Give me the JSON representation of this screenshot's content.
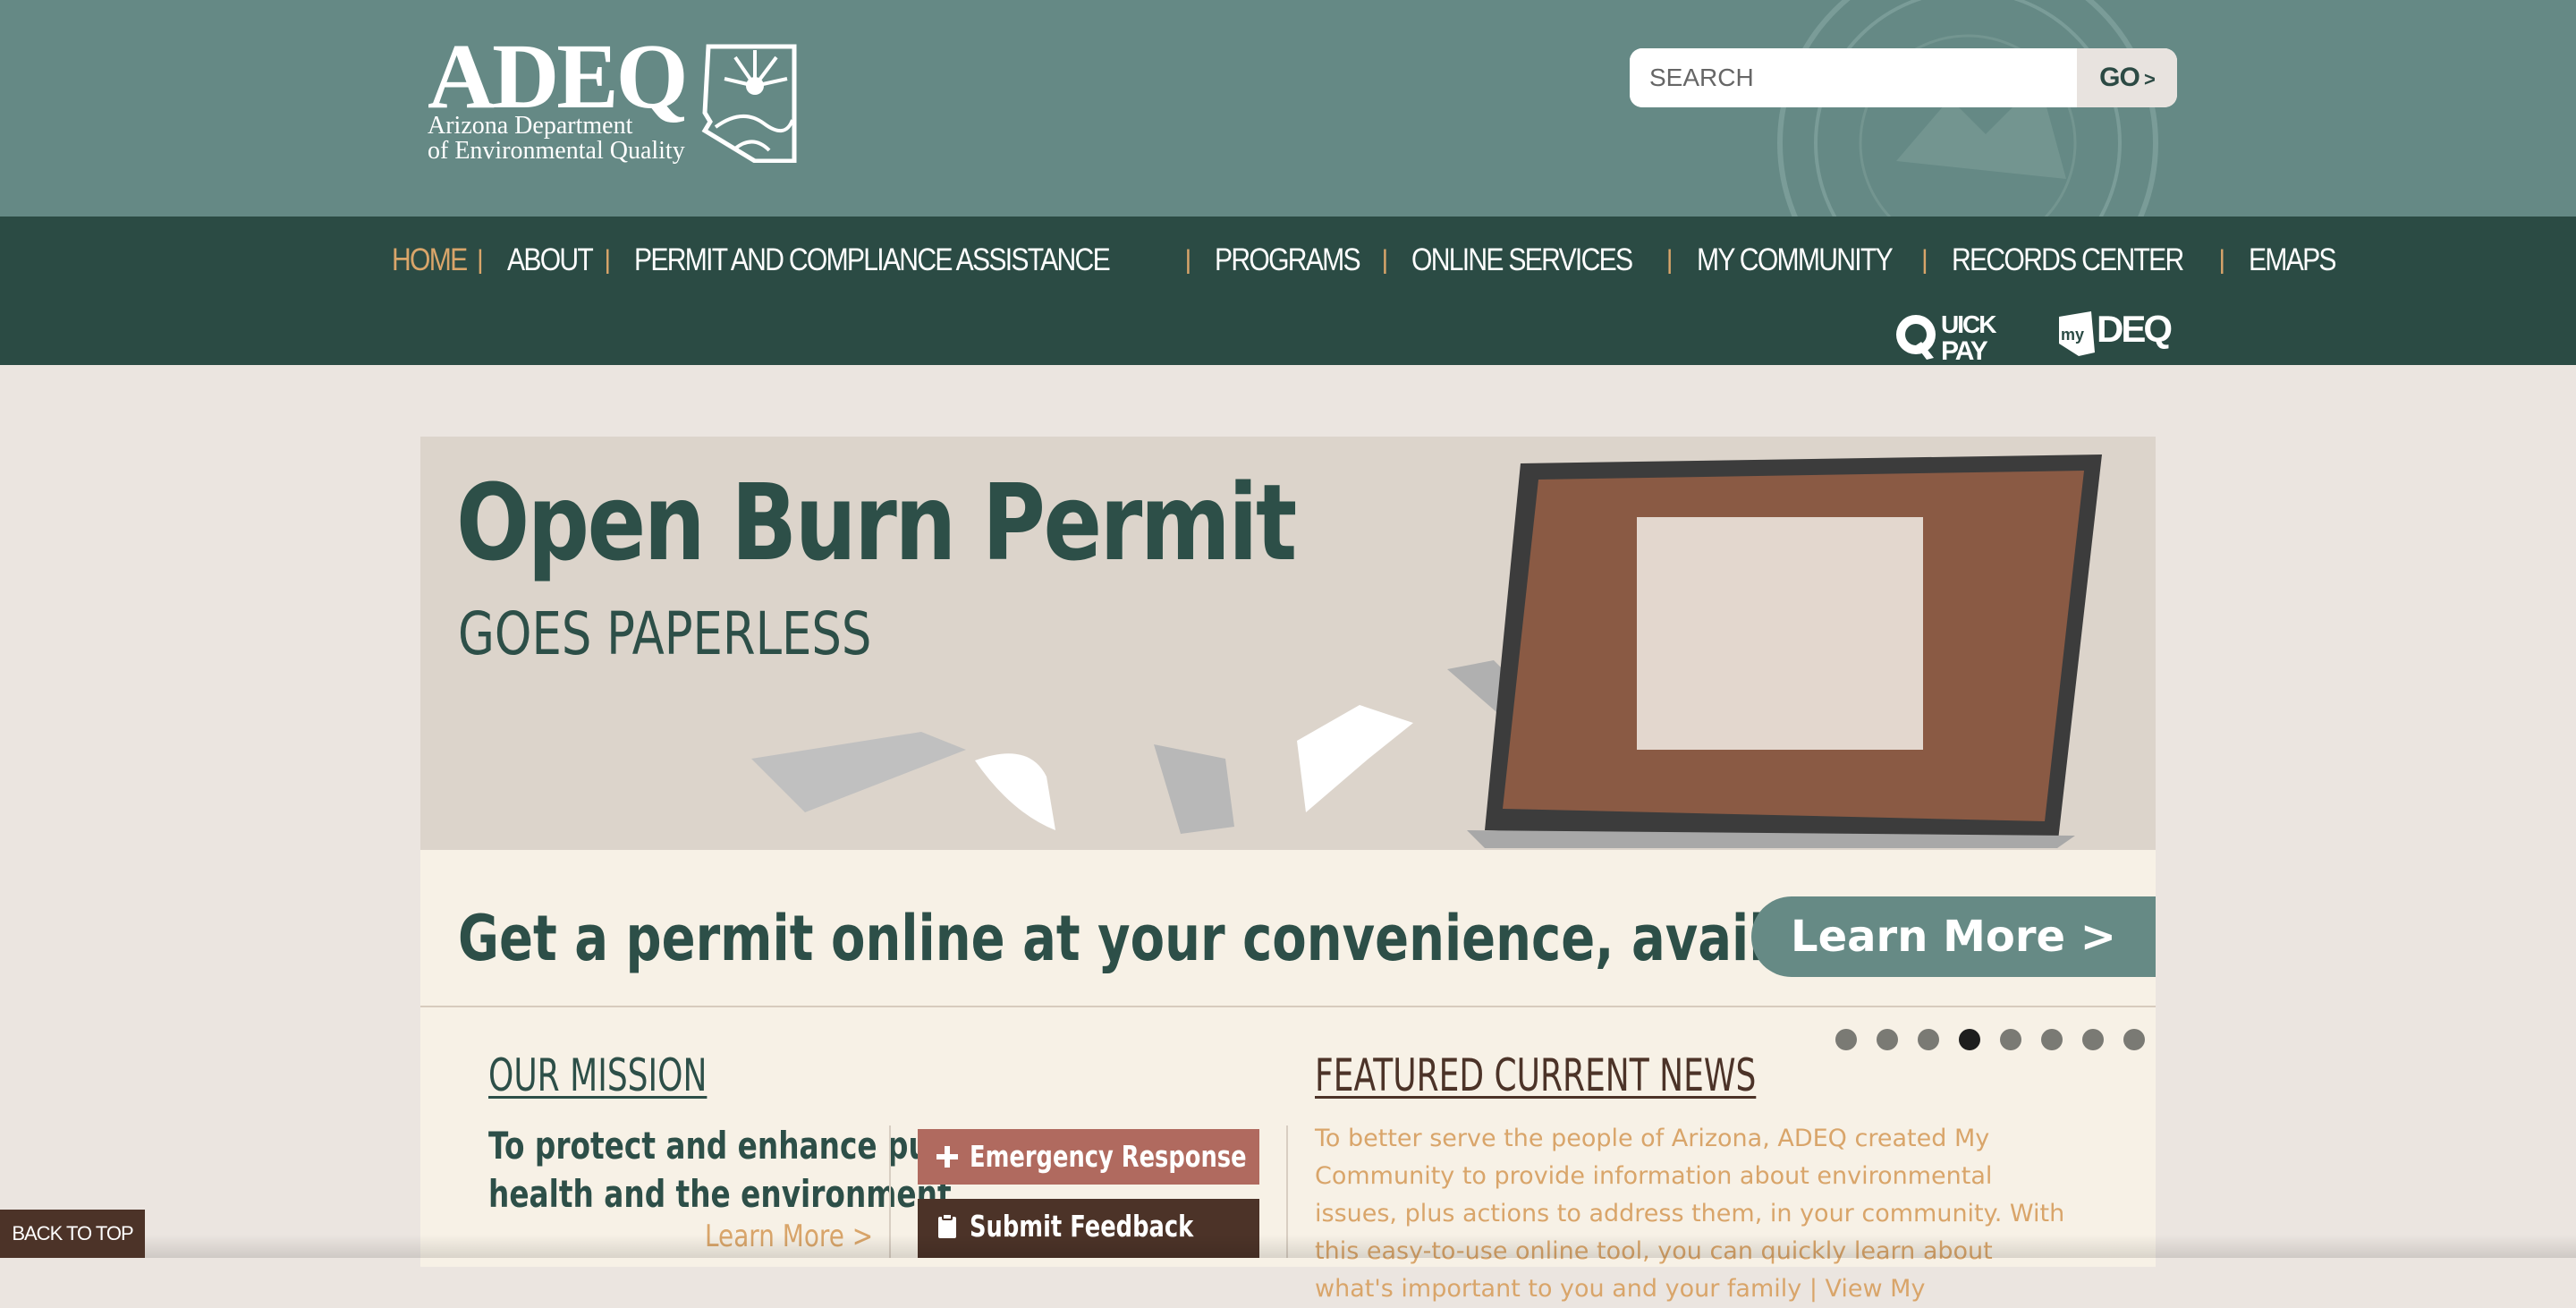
{
  "header": {
    "logo": {
      "wordmark": "ADEQ",
      "line1": "Arizona Department",
      "line2": "of Environmental Quality"
    },
    "search": {
      "placeholder": "SEARCH",
      "value": "",
      "go_label": "GO"
    },
    "quick_links": [
      {
        "name": "quick-pay",
        "label": "QUICK PAY"
      },
      {
        "name": "my-deq",
        "label": "myDEQ"
      }
    ]
  },
  "nav": {
    "items": [
      {
        "label": "HOME",
        "active": true
      },
      {
        "label": "ABOUT"
      },
      {
        "label": "PERMIT AND COMPLIANCE ASSISTANCE"
      },
      {
        "label": "PROGRAMS"
      },
      {
        "label": "ONLINE SERVICES"
      },
      {
        "label": "MY COMMUNITY"
      },
      {
        "label": "RECORDS CENTER"
      },
      {
        "label": "EMAPS"
      }
    ],
    "separator": "|"
  },
  "banner": {
    "title": "Open Burn Permit",
    "subtitle": "GOES PAPERLESS",
    "tagline": "Get a permit online at your convenience, available 24/7",
    "cta": "Learn More >",
    "slides_total": 8,
    "active_slide": 4
  },
  "mission": {
    "heading": "OUR MISSION",
    "line1": "To protect and enhance public",
    "line2": "health and the environment.",
    "learn_more": "Learn More"
  },
  "actions": {
    "emergency": "Emergency Response",
    "feedback": "Submit Feedback"
  },
  "news": {
    "heading": "FEATURED CURRENT NEWS",
    "body": "To better serve the people of Arizona, ADEQ created My Community to provide information about environmental issues, plus actions to address them, in your community. With this easy-to-use online tool, you can quickly learn about what's important to you and your family |",
    "link": "View My"
  },
  "back_to_top": "BACK TO TOP",
  "colors": {
    "header_bg": "#658985",
    "nav_bg": "#2b4b44",
    "accent": "#d9a56a",
    "page_bg": "#ebe5e0",
    "panel_bg": "#f7f1e6",
    "emergency_bg": "#b06a5f",
    "feedback_bg": "#4c3328"
  }
}
